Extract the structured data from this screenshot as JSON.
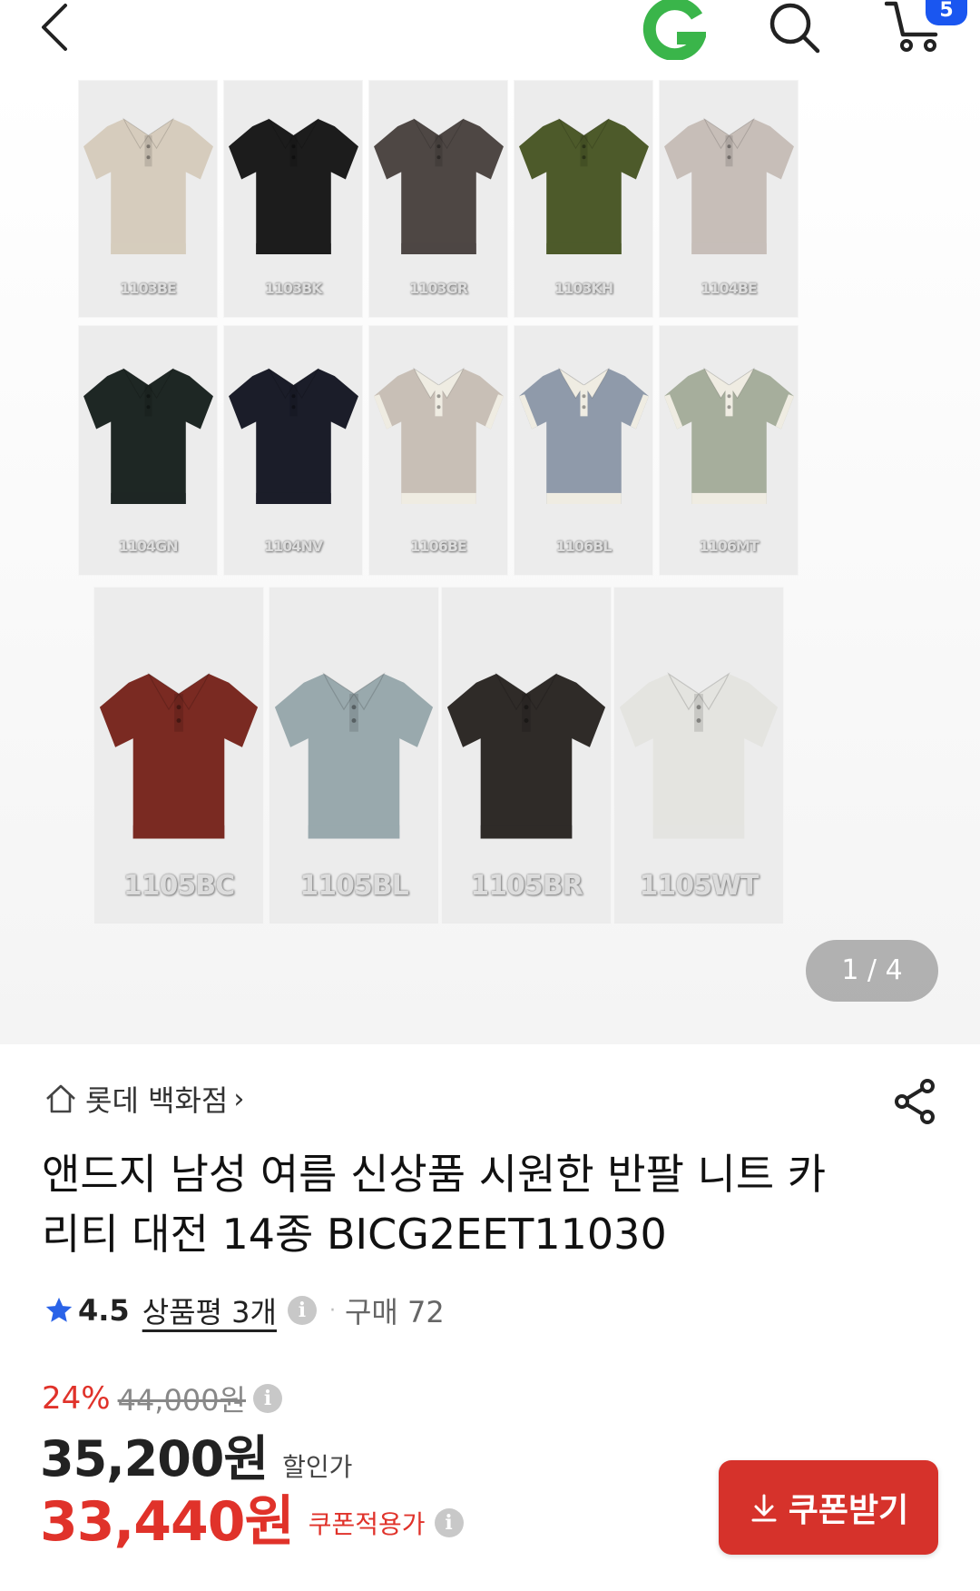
{
  "header": {
    "back": "back-icon",
    "logo": "G",
    "search": "search-icon",
    "cart_count": "5",
    "colors": {
      "logo_green": "#3ab54a",
      "badge_blue": "#1a56f0"
    }
  },
  "gallery": {
    "pager": "1 / 4",
    "rows": [
      [
        {
          "code": "1103BE",
          "color": "#d6ccbd"
        },
        {
          "code": "1103BK",
          "color": "#1c1c1c"
        },
        {
          "code": "1103GR",
          "color": "#4e4744"
        },
        {
          "code": "1103KH",
          "color": "#4d5a2a"
        },
        {
          "code": "1104BE",
          "color": "#c7beb8"
        }
      ],
      [
        {
          "code": "1104GN",
          "color": "#1e2724"
        },
        {
          "code": "1104NV",
          "color": "#1b1d29"
        },
        {
          "code": "1106BE",
          "color": "#c8bfb6",
          "trim": "#efece2"
        },
        {
          "code": "1106BL",
          "color": "#8f9aaa",
          "trim": "#efece2"
        },
        {
          "code": "1106MT",
          "color": "#a6ae9c",
          "trim": "#efece2"
        }
      ],
      [
        {
          "code": "1105BC",
          "color": "#7a2a22"
        },
        {
          "code": "1105BL",
          "color": "#99a9ad"
        },
        {
          "code": "1105BR",
          "color": "#2f2b28"
        },
        {
          "code": "1105WT",
          "color": "#e4e4e0"
        }
      ]
    ]
  },
  "product": {
    "store": "롯데 백화점",
    "title": "앤드지 남성 여름 신상품 시원한 반팔 니트 카리티 대전 14종 BICG2EET11030",
    "rating": "4.5",
    "reviews": "상품평 3개",
    "purchase": "구매 72",
    "discount_rate": "24%",
    "original_price": "44,000원",
    "sale_price": "35,200원",
    "sale_label": "할인가",
    "coupon_price": "33,440원",
    "coupon_label": "쿠폰적용가",
    "coupon_button": "쿠폰받기",
    "accent": "#e0322a"
  }
}
